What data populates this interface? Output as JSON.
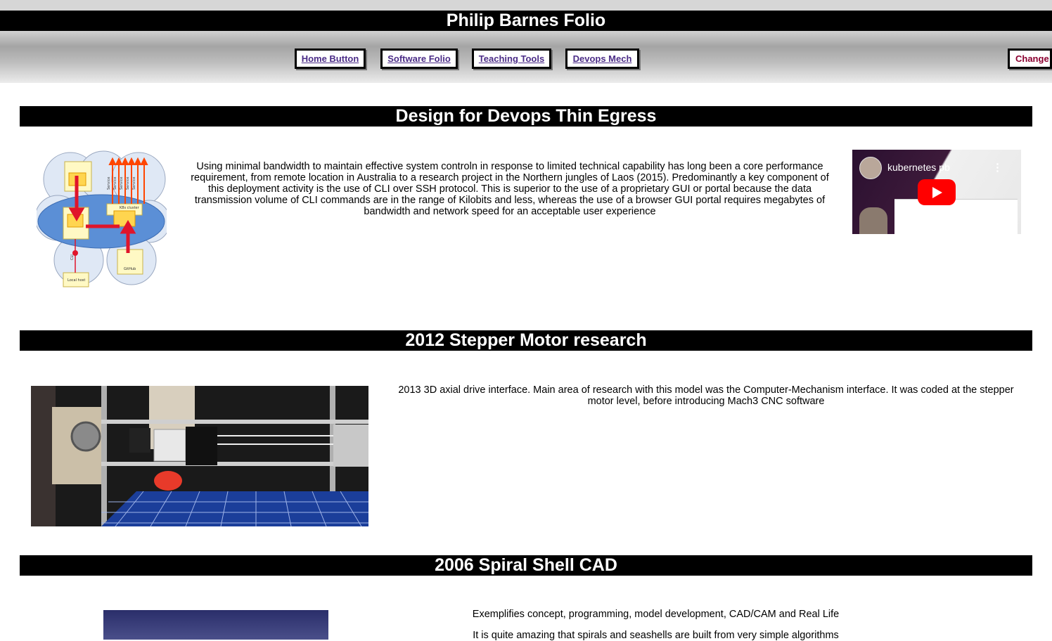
{
  "site": {
    "title": "Philip Barnes Folio"
  },
  "nav": {
    "items": [
      {
        "label": "Home Button"
      },
      {
        "label": "Software Folio"
      },
      {
        "label": "Teaching Tools"
      },
      {
        "label": "Devops Mech"
      }
    ],
    "change_label": "Change C"
  },
  "sections": [
    {
      "heading": "Design for Devops Thin Egress",
      "text": "Using minimal bandwidth to maintain effective system controln in response to limited technical capability has long been a core performance requirement, from remote location in Australia to a research project in the Northern jungles of Laos (2015). Predominantly a key component of this deployment activity is the use of CLI over SSH protocol. This is superior to the use of a proprietary GUI or portal because the data transmission volume of CLI commands are in the range of Kilobits and less, whereas the use of a browser GUI portal requires megabytes of bandwidth and network speed for an acceptable user experience",
      "video_title": "kubernetes pb"
    },
    {
      "heading": "2012 Stepper Motor research",
      "text": "2013 3D axial drive interface. Main area of research with this model was the Computer-Mechanism interface. It was coded at the stepper motor level, before introducing Mach3 CNC software"
    },
    {
      "heading": "2006 Spiral Shell CAD",
      "text1": "Exemplifies concept, programming, model development, CAD/CAM and Real Life",
      "text2": "It is quite amazing that spirals and seashells are built from very simple algorithms"
    }
  ],
  "diagram_labels": {
    "service": "Service",
    "local": "Local host",
    "cli": "CLI",
    "github": "GitHub",
    "k8s": "K8s cluster"
  }
}
